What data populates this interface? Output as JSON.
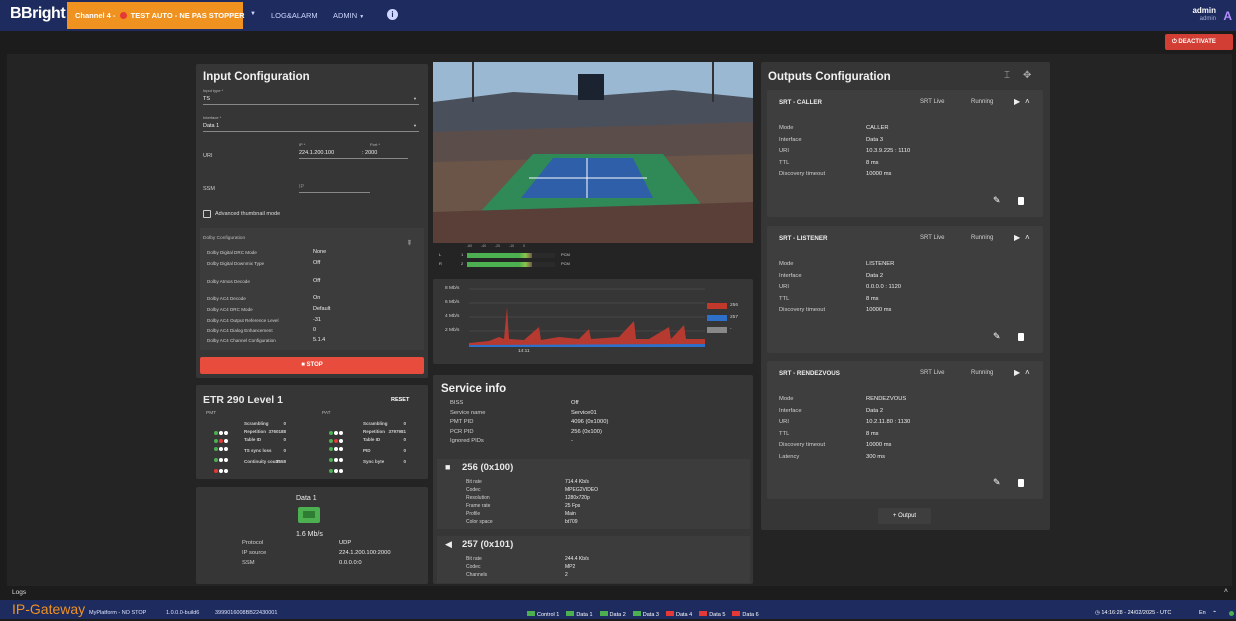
{
  "header": {
    "logo": "BBright",
    "channel": "Channel 4 - ",
    "channel_suffix": "TEST AUTO - NE PAS STOPPER",
    "menu_log": "LOG&ALARM",
    "menu_admin": "ADMIN",
    "user_name": "admin",
    "user_role": "admin",
    "avatar_letter": "A",
    "deactivate_label": "DEACTIVATE"
  },
  "input": {
    "title": "Input Configuration",
    "input_type_label": "Input type *",
    "input_type_value": "TS",
    "interface_label": "Interface *",
    "interface_value": "Data 1",
    "uri_label": "URI",
    "ip_label": "IP *",
    "ip_value": "224.1.200.100",
    "port_label": "Port *",
    "port_value": ": 2000",
    "ssm_label": "SSM",
    "ssm_placeholder": "IP",
    "advanced_label": "Advanced thumbnail mode",
    "dolby_title": "Dolby Configuration",
    "dolby_rows": [
      {
        "k": "Dolby Digital DRC Mode",
        "v": "None"
      },
      {
        "k": "Dolby Digital Downmix Type",
        "v": "Off"
      },
      {
        "k": "Dolby Atmos Decode",
        "v": "Off"
      },
      {
        "k": "Dolby AC4 Decode",
        "v": "On"
      },
      {
        "k": "Dolby AC4 DRC Mode",
        "v": "Default"
      },
      {
        "k": "Dolby AC4 Output Reference Level",
        "v": "-31"
      },
      {
        "k": "Dolby AC4 Dialog Enhancement",
        "v": "0"
      },
      {
        "k": "Dolby AC4 Channel Configuration",
        "v": "5.1.4"
      }
    ],
    "stop_label": "STOP"
  },
  "etr": {
    "title": "ETR 290 Level 1",
    "reset_label": "RESET",
    "pmt_label": "PMT",
    "pat_label": "PAT",
    "left_rows": [
      {
        "k": "Scrambling",
        "v": "0",
        "c": [
          "#4caf50",
          "#ffffff",
          "#ffffff"
        ]
      },
      {
        "k": "Repetition",
        "v": "3760188",
        "c": [
          "#4caf50",
          "#e53935",
          "#ffffff"
        ]
      },
      {
        "k": "Table ID",
        "v": "0",
        "c": [
          "#4caf50",
          "#ffffff",
          "#ffffff"
        ]
      },
      {
        "k": "TS sync loss",
        "v": "0",
        "c": [
          "#4caf50",
          "#ffffff",
          "#ffffff"
        ]
      },
      {
        "k": "Continuity count",
        "v": "7558",
        "c": [
          "#e53935",
          "#ffffff",
          "#ffffff"
        ]
      }
    ],
    "right_rows": [
      {
        "k": "Scrambling",
        "v": "0",
        "c": [
          "#4caf50",
          "#ffffff",
          "#ffffff"
        ]
      },
      {
        "k": "Repetition",
        "v": "3797981",
        "c": [
          "#4caf50",
          "#e53935",
          "#ffffff"
        ]
      },
      {
        "k": "Table ID",
        "v": "0",
        "c": [
          "#4caf50",
          "#ffffff",
          "#ffffff"
        ]
      },
      {
        "k": "PID",
        "v": "0",
        "c": [
          "#4caf50",
          "#ffffff",
          "#ffffff"
        ]
      },
      {
        "k": "Sync byte",
        "v": "0",
        "c": [
          "#4caf50",
          "#ffffff",
          "#ffffff"
        ]
      }
    ]
  },
  "iface": {
    "title": "Data 1",
    "rate": "1.6 Mb/s",
    "rows": [
      {
        "k": "Protocol",
        "v": "UDP"
      },
      {
        "k": "IP source",
        "v": "224.1.200.100:2000"
      },
      {
        "k": "SSM",
        "v": "0.0.0.0:0"
      }
    ]
  },
  "audio_meter": {
    "scale": [
      "-60",
      "-40",
      "-20",
      "-10",
      "0"
    ],
    "channels": [
      {
        "name": "L",
        "num": "1",
        "tag": "PCM",
        "level": 0.74
      },
      {
        "name": "R",
        "num": "2",
        "tag": "PCM",
        "level": 0.74
      }
    ]
  },
  "bitrate_chart": {
    "yticks": [
      "8 Mb/s",
      "6 Mb/s",
      "4 Mb/s",
      "2 Mb/s"
    ],
    "xlabel": "14:11",
    "legend": [
      {
        "name": "256",
        "color": "#c0392b"
      },
      {
        "name": "257",
        "color": "#2e6fc9"
      },
      {
        "name": "-",
        "color": "#888888"
      }
    ]
  },
  "service": {
    "title": "Service info",
    "rows": [
      {
        "k": "BISS",
        "v": "Off"
      },
      {
        "k": "Service name",
        "v": "Service01"
      },
      {
        "k": "PMT PID",
        "v": "4096 (0x1000)"
      },
      {
        "k": "PCR PID",
        "v": "256 (0x100)"
      },
      {
        "k": "Ignored PIDs",
        "v": "-"
      }
    ],
    "video_title": "256 (0x100)",
    "video_rows": [
      {
        "k": "Bit rate",
        "v": "714.4 Kb/s"
      },
      {
        "k": "Codec",
        "v": "MPEG2VIDEO"
      },
      {
        "k": "Resolution",
        "v": "1280x720p"
      },
      {
        "k": "Frame rate",
        "v": "25 Fps"
      },
      {
        "k": "Profile",
        "v": "Main"
      },
      {
        "k": "Color space",
        "v": "bt709"
      }
    ],
    "audio_title": "257 (0x101)",
    "audio_rows": [
      {
        "k": "Bit rate",
        "v": "244.4 Kb/s"
      },
      {
        "k": "Codec",
        "v": "MP2"
      },
      {
        "k": "Channels",
        "v": "2"
      }
    ]
  },
  "outputs": {
    "title": "Outputs Configuration",
    "add_label": "+ Output",
    "cards": [
      {
        "name": "SRT - CALLER",
        "type": "SRT Live",
        "status": "Running",
        "rows": [
          {
            "k": "Mode",
            "v": "CALLER"
          },
          {
            "k": "Interface",
            "v": "Data 3"
          },
          {
            "k": "URI",
            "v": "10.3.9.225 : 1110"
          },
          {
            "k": "TTL",
            "v": "8 ms"
          },
          {
            "k": "Discovery timeout",
            "v": "10000 ms"
          }
        ]
      },
      {
        "name": "SRT - LISTENER",
        "type": "SRT Live",
        "status": "Running",
        "rows": [
          {
            "k": "Mode",
            "v": "LISTENER"
          },
          {
            "k": "Interface",
            "v": "Data 2"
          },
          {
            "k": "URI",
            "v": "0.0.0.0 : 1120"
          },
          {
            "k": "TTL",
            "v": "8 ms"
          },
          {
            "k": "Discovery timeout",
            "v": "10000 ms"
          }
        ]
      },
      {
        "name": "SRT - RENDEZVOUS",
        "type": "SRT Live",
        "status": "Running",
        "rows": [
          {
            "k": "Mode",
            "v": "RENDEZVOUS"
          },
          {
            "k": "Interface",
            "v": "Data 2"
          },
          {
            "k": "URI",
            "v": "10.2.11.80 : 1130"
          },
          {
            "k": "TTL",
            "v": "8 ms"
          },
          {
            "k": "Discovery timeout",
            "v": "10000 ms"
          },
          {
            "k": "Latency",
            "v": "300 ms"
          }
        ]
      }
    ]
  },
  "footer": {
    "logs_label": "Logs",
    "product": "IP-Gateway",
    "platform": "MyPlatform - NO STOP",
    "version": "1.0.0.0-build6",
    "serial": "3999016008BB22430001",
    "chips": [
      {
        "label": "Control 1",
        "color": "#4caf50"
      },
      {
        "label": "Data 1",
        "color": "#4caf50"
      },
      {
        "label": "Data 2",
        "color": "#4caf50"
      },
      {
        "label": "Data 3",
        "color": "#4caf50"
      },
      {
        "label": "Data 4",
        "color": "#e53935"
      },
      {
        "label": "Data 5",
        "color": "#e53935"
      },
      {
        "label": "Data 6",
        "color": "#e53935"
      }
    ],
    "datetime": "14:16:28 - 24/02/2025 - UTC",
    "lang": "En"
  }
}
